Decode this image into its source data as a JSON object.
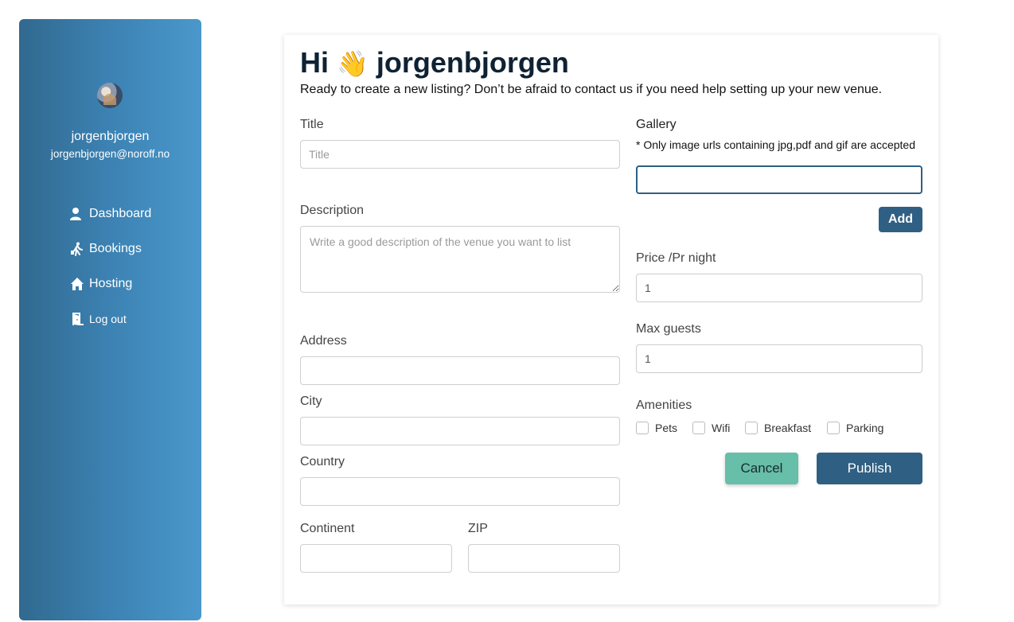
{
  "sidebar": {
    "user_name": "jorgenbjorgen",
    "user_email": "jorgenbjorgen@noroff.no",
    "nav": [
      {
        "label": "Dashboard",
        "icon": "user-icon"
      },
      {
        "label": "Bookings",
        "icon": "walking-person-icon"
      },
      {
        "label": "Hosting",
        "icon": "house-icon"
      },
      {
        "label": "Log out",
        "icon": "door-exit-icon"
      }
    ]
  },
  "header": {
    "greeting_prefix": "Hi",
    "wave_emoji": "👋",
    "username": "jorgenbjorgen",
    "intro": "Ready to create a new listing? Don’t be afraid to contact us if you need help setting up your new venue."
  },
  "form": {
    "title_label": "Title",
    "title_placeholder": "Title",
    "description_label": "Description",
    "description_placeholder": "Write a good description of the venue you want to list",
    "address_label": "Address",
    "city_label": "City",
    "country_label": "Country",
    "continent_label": "Continent",
    "zip_label": "ZIP",
    "gallery_label": "Gallery",
    "gallery_note": "* Only image urls containing jpg,pdf and gif are accepted",
    "add_label": "Add",
    "price_label": "Price /Pr night",
    "price_value": "1",
    "guests_label": "Max guests",
    "guests_value": "1",
    "amenities_label": "Amenities",
    "amenities": [
      "Pets",
      "Wifi",
      "Breakfast",
      "Parking"
    ],
    "cancel_label": "Cancel",
    "publish_label": "Publish"
  },
  "colors": {
    "sidebar_gradient_start": "#31698f",
    "sidebar_gradient_end": "#4a98cc",
    "primary": "#2f5f82",
    "cancel": "#67bea9"
  }
}
